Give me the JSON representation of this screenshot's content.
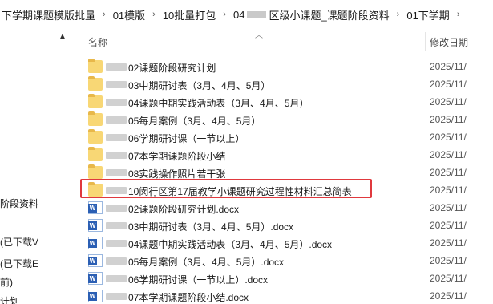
{
  "breadcrumb": [
    "下学期课题模版批量",
    "01模版",
    "10批量打包",
    "04",
    "区级小课题_课题阶段资料",
    "01下学期"
  ],
  "breadcrumb_sep": "›",
  "header": {
    "name_label": "名称",
    "date_label": "修改日期"
  },
  "nav": {
    "items": [
      "阶段资料",
      "(已下载V",
      "(已下载E",
      "前)",
      "计划"
    ]
  },
  "files": [
    {
      "type": "folder",
      "name": "02课题阶段研究计划",
      "date": "2025/11/"
    },
    {
      "type": "folder",
      "name": "03中期研讨表（3月、4月、5月）",
      "date": "2025/11/"
    },
    {
      "type": "folder",
      "name": "04课题中期实践活动表（3月、4月、5月）",
      "date": "2025/11/"
    },
    {
      "type": "folder",
      "name": "05每月案例（3月、4月、5月）",
      "date": "2025/11/"
    },
    {
      "type": "folder",
      "name": "06学期研讨课（一节以上）",
      "date": "2025/11/"
    },
    {
      "type": "folder",
      "name": "07本学期课题阶段小结",
      "date": "2025/11/"
    },
    {
      "type": "folder",
      "name": "08实践操作照片若干张",
      "date": "2025/11/"
    },
    {
      "type": "folder",
      "name": "10闵行区第17届教学小课题研究过程性材料汇总简表",
      "date": "2025/11/"
    },
    {
      "type": "docx",
      "name": "02课题阶段研究计划.docx",
      "date": "2025/11/"
    },
    {
      "type": "docx",
      "name": "03中期研讨表（3月、4月、5月）.docx",
      "date": "2025/11/"
    },
    {
      "type": "docx",
      "name": "04课题中期实践活动表（3月、4月、5月）.docx",
      "date": "2025/11/"
    },
    {
      "type": "docx",
      "name": "05每月案例（3月、4月、5月）.docx",
      "date": "2025/11/"
    },
    {
      "type": "docx",
      "name": "06学期研讨课（一节以上）.docx",
      "date": "2025/11/"
    },
    {
      "type": "docx",
      "name": "07本学期课题阶段小结.docx",
      "date": "2025/11/"
    }
  ],
  "colors": {
    "highlight": "#e0393e",
    "folder": "#f8d775",
    "word": "#2b5fb4"
  }
}
